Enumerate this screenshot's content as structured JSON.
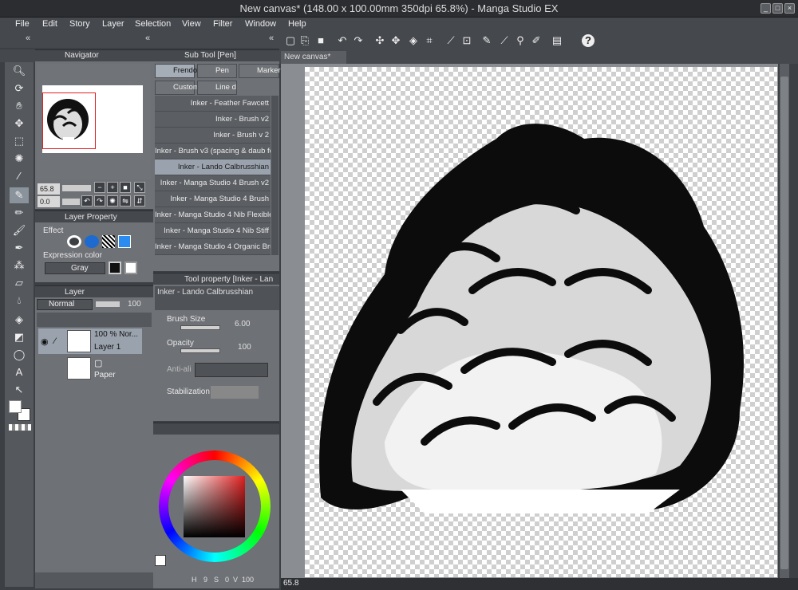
{
  "window": {
    "title": "New canvas* (148.00 x 100.00mm 350dpi 65.8%) - Manga Studio EX"
  },
  "menu": [
    "File",
    "Edit",
    "Story",
    "Layer",
    "Selection",
    "View",
    "Filter",
    "Window",
    "Help"
  ],
  "toolbar_icons": [
    "new-icon",
    "open-icon",
    "save-icon",
    "save-as-icon",
    "undo-icon",
    "redo-icon",
    "transform-icon",
    "move-icon",
    "fill-icon",
    "crop-icon",
    "ruler-icon",
    "ruler-snap-icon",
    "pen-pressure-icon",
    "eraser-snap-icon",
    "paint-icon",
    "layout-icon",
    "help-icon"
  ],
  "navigator": {
    "tab": "Navigator",
    "zoom": "65.8",
    "rotation": "0.0"
  },
  "layer_property": {
    "tab": "Layer Property",
    "effect_label": "Effect",
    "expression_label": "Expression color",
    "expression_value": "Gray"
  },
  "layer": {
    "tab": "Layer",
    "blend": "Normal",
    "opacity": "100",
    "layers": [
      {
        "name": "Layer 1",
        "info": "100 % Nor..."
      },
      {
        "name": "Paper",
        "info": ""
      }
    ]
  },
  "subtool": {
    "title": "Sub Tool [Pen]",
    "tabs": [
      "Frendo",
      "Pen",
      "Marker",
      "Custom",
      "Line d"
    ],
    "brushes": [
      "Inker - Feather Fawcett",
      "Inker - Brush v2",
      "Inker - Brush v 2",
      "Inker - Brush v3 (spacing & daub for",
      "Inker - Lando Calbrusshian",
      "Inker - Manga Studio 4 Brush v2",
      "Inker - Manga Studio 4 Brush",
      "Inker - Manga Studio 4 Nib Flexible",
      "Inker - Manga Studio 4 Nib Stiff",
      "Inker - Manga Studio 4 Organic Bru"
    ],
    "selected_index": 4
  },
  "toolprop": {
    "title": "Tool property [Inker - Lan",
    "preset": "Inker - Lando Calbrusshian",
    "brush_size_label": "Brush Size",
    "brush_size": "6.00",
    "opacity_label": "Opacity",
    "opacity": "100",
    "antialias_label": "Anti-ali",
    "stabilization_label": "Stabilization"
  },
  "color": {
    "h": "9",
    "s": "0",
    "v": "100",
    "h_label": "H",
    "s_label": "S",
    "v_label": "V"
  },
  "canvas": {
    "tab": "New canvas*",
    "zoom": "65.8"
  }
}
